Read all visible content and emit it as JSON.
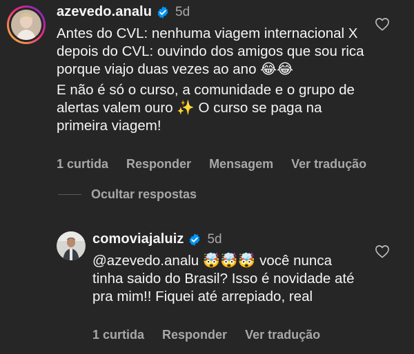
{
  "comments": [
    {
      "username": "azevedo.analu",
      "verified": true,
      "time": "5d",
      "paragraphs": [
        "Antes do CVL: nenhuma viagem internacional X depois do CVL: ouvindo dos amigos que sou rica porque viajo duas vezes ao ano 😂😂",
        "E não é só o curso, a comunidade e o grupo de alertas valem ouro ✨ O curso se paga na primeira viagem!"
      ],
      "likes": "1 curtida",
      "reply_label": "Responder",
      "message_label": "Mensagem",
      "translate_label": "Ver tradução",
      "heart_icon": "heart-outline-icon"
    }
  ],
  "replies_toggle": "Ocultar respostas",
  "reply": {
    "username": "comoviajaluiz",
    "verified": true,
    "time": "5d",
    "text": "@azevedo.analu 🤯🤯🤯 você nunca tinha saido do Brasil? Isso é novidade até pra mim!! Fiquei até arrepiado, real",
    "likes": "1 curtida",
    "reply_label": "Responder",
    "translate_label": "Ver tradução",
    "heart_icon": "heart-outline-icon"
  },
  "colors": {
    "background": "#262626",
    "text": "#f5f5f5",
    "muted": "#a8a8a8",
    "verified": "#0095f6"
  }
}
